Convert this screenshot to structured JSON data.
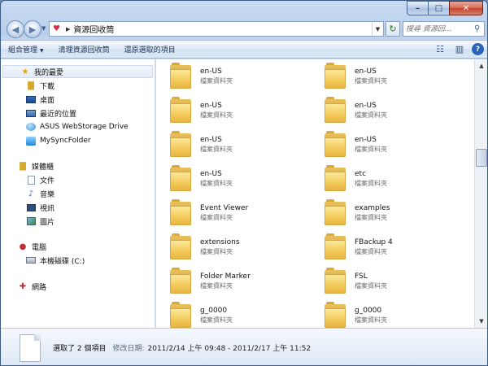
{
  "window": {
    "caption": {
      "minimize": "–",
      "maximize": "□",
      "close": "✕"
    }
  },
  "navbar": {
    "back": "◀",
    "forward": "▶",
    "path": "資源回收筒",
    "search_placeholder": "搜尋 資源回...",
    "refresh": "↻"
  },
  "toolbar": {
    "organize": "組合管理",
    "empty_bin": "清理資源回收筒",
    "restore_selected": "還原選取的項目"
  },
  "sidebar": {
    "favorites": {
      "label": "我的最愛",
      "items": [
        {
          "label": "下載",
          "icon": "downloads-folder-icon"
        },
        {
          "label": "桌面",
          "icon": "desktop-icon"
        },
        {
          "label": "最近的位置",
          "icon": "recent-places-icon"
        },
        {
          "label": "ASUS WebStorage Drive",
          "icon": "asus-webstorage-icon"
        },
        {
          "label": "MySyncFolder",
          "icon": "sync-folder-icon"
        }
      ]
    },
    "libraries": {
      "label": "媒體櫃",
      "items": [
        {
          "label": "文件",
          "icon": "documents-icon"
        },
        {
          "label": "音樂",
          "icon": "music-icon"
        },
        {
          "label": "視訊",
          "icon": "video-icon"
        },
        {
          "label": "圖片",
          "icon": "pictures-icon"
        }
      ]
    },
    "computer": {
      "label": "電腦",
      "items": [
        {
          "label": "本機磁碟 (C:)",
          "icon": "drive-icon"
        }
      ]
    },
    "network": {
      "label": "網路"
    }
  },
  "items": [
    {
      "name": "en-US",
      "type": "檔案資料夾"
    },
    {
      "name": "en-US",
      "type": "檔案資料夾"
    },
    {
      "name": "en-US",
      "type": "檔案資料夾"
    },
    {
      "name": "en-US",
      "type": "檔案資料夾"
    },
    {
      "name": "en-US",
      "type": "檔案資料夾"
    },
    {
      "name": "en-US",
      "type": "檔案資料夾"
    },
    {
      "name": "en-US",
      "type": "檔案資料夾"
    },
    {
      "name": "etc",
      "type": "檔案資料夾"
    },
    {
      "name": "Event Viewer",
      "type": "檔案資料夾"
    },
    {
      "name": "examples",
      "type": "檔案資料夾"
    },
    {
      "name": "extensions",
      "type": "檔案資料夾"
    },
    {
      "name": "FBackup 4",
      "type": "檔案資料夾"
    },
    {
      "name": "Folder Marker",
      "type": "檔案資料夾"
    },
    {
      "name": "FSL",
      "type": "檔案資料夾"
    },
    {
      "name": "g_0000",
      "type": "檔案資料夾"
    },
    {
      "name": "g_0000",
      "type": "檔案資料夾"
    }
  ],
  "details": {
    "selection": "選取了 2 個項目",
    "modified_label": "修改日期:",
    "modified_value": "2011/2/14 上午 09:48 - 2011/2/17 上午 11:52"
  },
  "colors": {
    "titlebar": "#c9dcf3",
    "folder": "#f2c95a",
    "accent": "#2a63b8"
  }
}
